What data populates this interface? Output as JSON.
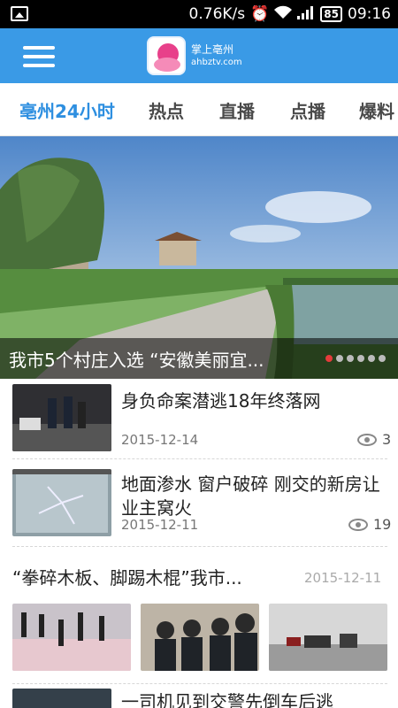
{
  "status_bar": {
    "network_speed": "0.76K/s",
    "battery": "85",
    "time": "09:16",
    "icons": [
      "image-notification-icon",
      "alarm-icon",
      "wifi-icon",
      "signal-icon",
      "battery-icon"
    ]
  },
  "header": {
    "logo_title": "掌上亳州",
    "logo_domain": "ahbztv.com",
    "brand_color": "#3a9ae6"
  },
  "tabs": [
    {
      "label": "亳州24小时",
      "active": true
    },
    {
      "label": "热点",
      "active": false
    },
    {
      "label": "直播",
      "active": false
    },
    {
      "label": "点播",
      "active": false
    },
    {
      "label": "爆料",
      "active": false
    }
  ],
  "banner": {
    "caption": "我市5个村庄入选 “安徽美丽宜...",
    "active_dot": 1,
    "dot_count": 6
  },
  "news": [
    {
      "title": "身负命案潜逃18年终落网",
      "date": "2015-12-14",
      "views": "3"
    },
    {
      "title": "地面渗水 窗户破碎 刚交的新房让业主窝火",
      "date": "2015-12-11",
      "views": "19"
    },
    {
      "title": "“拳碎木板、脚踢木棍”我市...",
      "date": "2015-12-11"
    },
    {
      "title": "一司机见到交警先倒车后逃"
    }
  ],
  "accent_color": "#2e8fe0"
}
